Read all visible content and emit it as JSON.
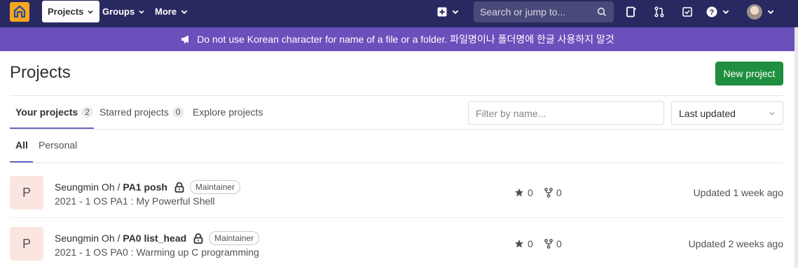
{
  "navbar": {
    "projects_label": "Projects",
    "groups_label": "Groups",
    "more_label": "More",
    "search_placeholder": "Search or jump to..."
  },
  "banner": {
    "text": "Do not use Korean character for name of a file or a folder. 파일명이나 폴더명에 한글 사용하지 말것"
  },
  "page": {
    "title": "Projects",
    "new_project_label": "New project"
  },
  "tabs": [
    {
      "label": "Your projects",
      "count": "2"
    },
    {
      "label": "Starred projects",
      "count": "0"
    },
    {
      "label": "Explore projects"
    }
  ],
  "filter": {
    "placeholder": "Filter by name...",
    "sort_value": "Last updated"
  },
  "subtabs": [
    "All",
    "Personal"
  ],
  "projects": [
    {
      "avatar_letter": "P",
      "namespace": "Seungmin Oh /",
      "name": "PA1 posh",
      "role": "Maintainer",
      "description": "2021 - 1 OS PA1 : My Powerful Shell",
      "stars": "0",
      "forks": "0",
      "updated": "Updated 1 week ago"
    },
    {
      "avatar_letter": "P",
      "namespace": "Seungmin Oh /",
      "name": "PA0 list_head",
      "role": "Maintainer",
      "description": "2021 - 1 OS PA0 : Warming up C programming",
      "stars": "0",
      "forks": "0",
      "updated": "Updated 2 weeks ago"
    }
  ],
  "colors": {
    "navbar": "#292961",
    "banner": "#6b4fbb",
    "primary_button": "#1f8f3f",
    "logo": "#f5a81e"
  }
}
